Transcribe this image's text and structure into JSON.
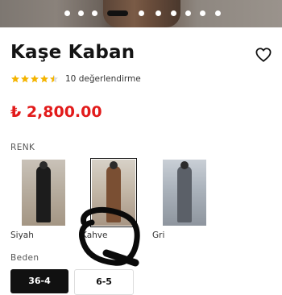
{
  "product": {
    "title": "Kaşe Kaban",
    "rating": {
      "stars": 4.5,
      "text": "10 değerlendirme"
    },
    "price": "₺ 2,800.00"
  },
  "carousel": {
    "count": 10,
    "active_index": 2
  },
  "colors": {
    "section_label": "RENK",
    "options": [
      {
        "name": "Siyah",
        "selected": false
      },
      {
        "name": "Kahve",
        "selected": true
      },
      {
        "name": "Gri",
        "selected": false
      }
    ]
  },
  "size": {
    "section_label": "Beden",
    "options": [
      "36-4",
      "6-5"
    ]
  },
  "theme": {
    "price_color": "#e21b1b",
    "star_color": "#f4b400",
    "text_color": "#141414"
  },
  "icons": {
    "favorite": "heart-outline-icon",
    "star": "star-icon"
  }
}
